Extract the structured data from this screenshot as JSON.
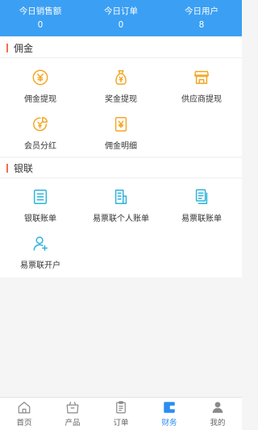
{
  "stats": [
    {
      "label": "今日销售额",
      "value": "0"
    },
    {
      "label": "今日订单",
      "value": "0"
    },
    {
      "label": "今日用户",
      "value": "8"
    }
  ],
  "sections": [
    {
      "title": "佣金",
      "items": [
        {
          "label": "佣金提现",
          "icon": "yen-coin-icon"
        },
        {
          "label": "奖金提现",
          "icon": "money-bag-icon"
        },
        {
          "label": "供应商提现",
          "icon": "shop-icon"
        },
        {
          "label": "会员分红",
          "icon": "dividend-icon"
        },
        {
          "label": "佣金明细",
          "icon": "yen-note-icon"
        }
      ]
    },
    {
      "title": "银联",
      "items": [
        {
          "label": "银联账单",
          "icon": "document-icon"
        },
        {
          "label": "易票联个人账单",
          "icon": "bill-icon"
        },
        {
          "label": "易票联账单",
          "icon": "files-icon"
        },
        {
          "label": "易票联开户",
          "icon": "add-user-icon"
        }
      ]
    }
  ],
  "tabs": [
    {
      "label": "首页",
      "icon": "home-icon"
    },
    {
      "label": "产品",
      "icon": "bag-icon"
    },
    {
      "label": "订单",
      "icon": "clipboard-icon"
    },
    {
      "label": "财务",
      "icon": "wallet-icon",
      "active": true
    },
    {
      "label": "我的",
      "icon": "person-icon"
    }
  ],
  "colors": {
    "header": "#3b9ff3",
    "orange": "#f5a623",
    "cyan": "#2bb3d9",
    "tab_active": "#2a8df0",
    "accent_bar": "#f36e4e"
  }
}
